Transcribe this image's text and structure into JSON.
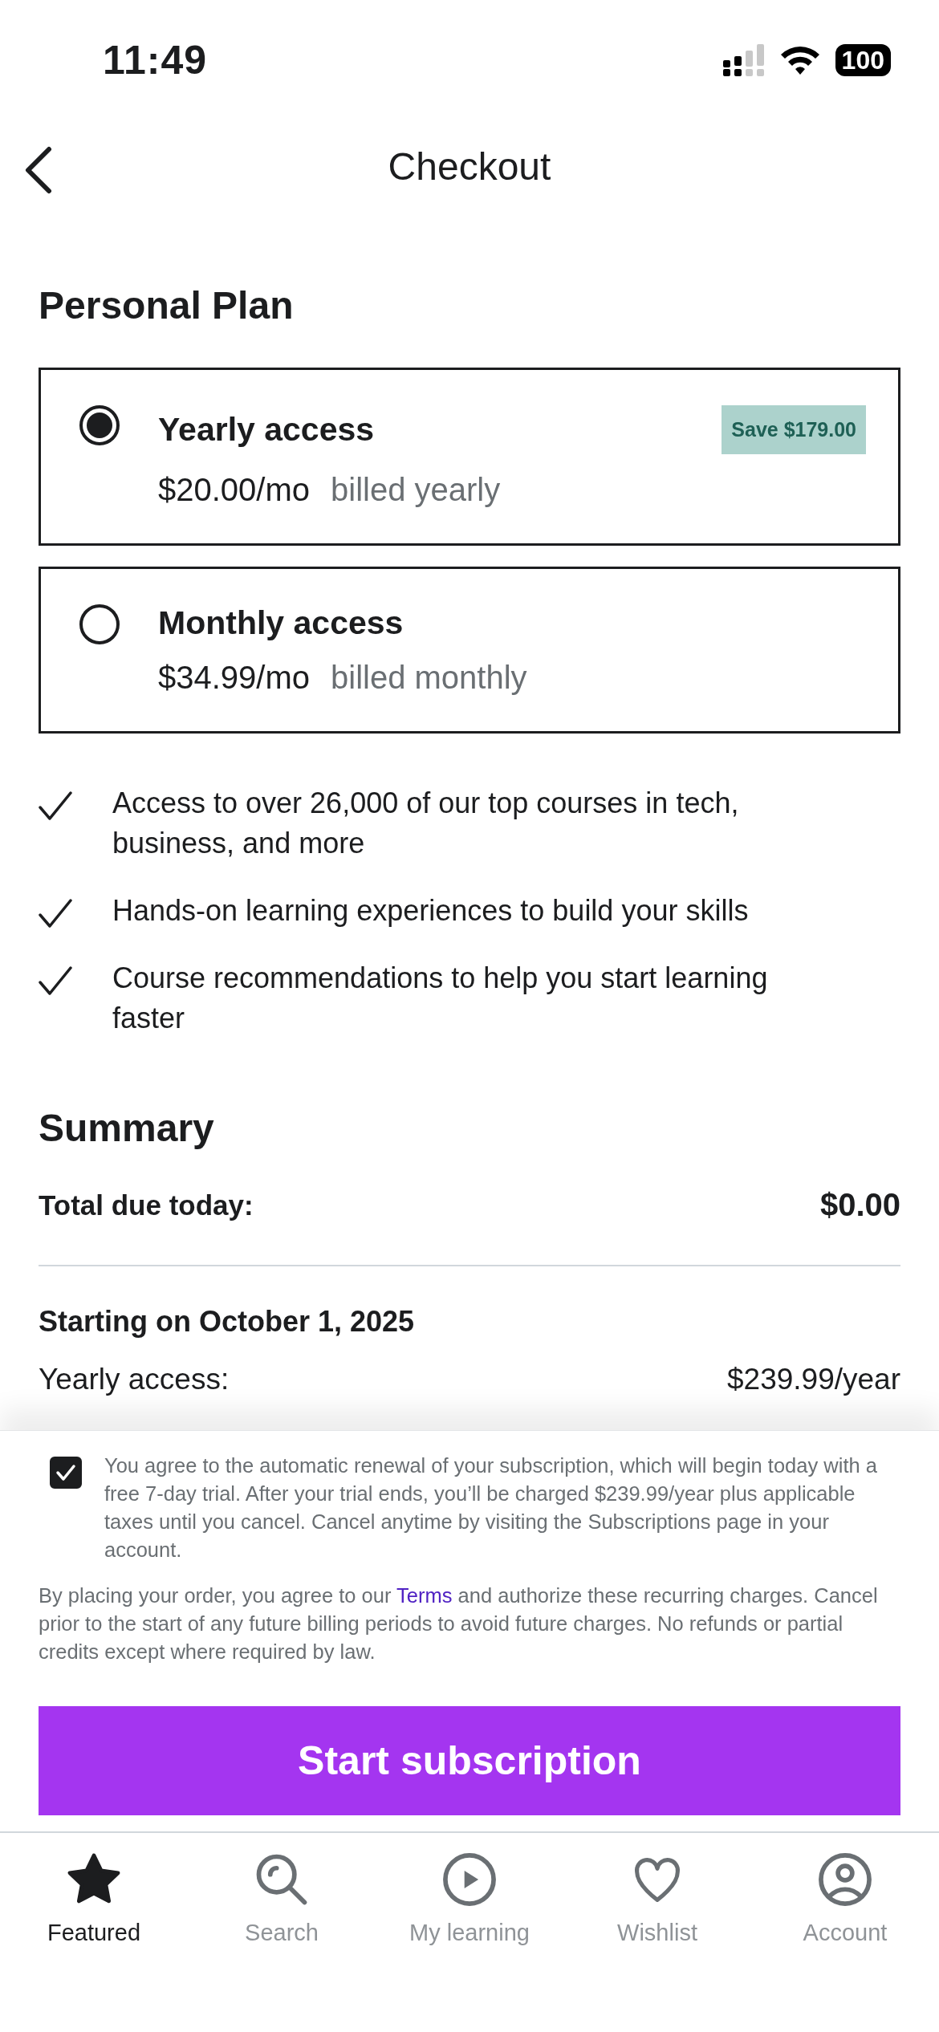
{
  "status_bar": {
    "time": "11:49",
    "battery": "100"
  },
  "header": {
    "title": "Checkout"
  },
  "plan_heading": "Personal Plan",
  "plans": [
    {
      "title": "Yearly access",
      "price": "$20.00/mo",
      "billing": "billed yearly",
      "badge": "Save $179.00",
      "selected": true
    },
    {
      "title": "Monthly access",
      "price": "$34.99/mo",
      "billing": "billed monthly",
      "selected": false
    }
  ],
  "features": [
    "Access to over 26,000 of our top courses in tech, business, and more",
    "Hands-on learning experiences to build your skills",
    "Course recommendations to help you start learning faster"
  ],
  "summary": {
    "heading": "Summary",
    "total_label": "Total due today:",
    "total_value": "$0.00",
    "start_heading": "Starting on October 1, 2025",
    "lines": [
      {
        "label": "Yearly access:",
        "value": "$239.99/year"
      }
    ]
  },
  "consent": {
    "checked": true,
    "text": "You agree to the automatic renewal of your subscription, which will begin today with a free 7-day trial. After your trial ends, you’ll be charged $239.99/year plus applicable taxes until you cancel. Cancel anytime by visiting the Subscriptions page in your account."
  },
  "legal": {
    "before": "By placing your order, you agree to our",
    "link": "Terms",
    "after": "and authorize these recurring charges. Cancel prior to the start of any future billing periods to avoid future charges. No refunds or partial credits except where required by law."
  },
  "cta": "Start subscription",
  "tabs": [
    {
      "label": "Featured",
      "kind": "star",
      "selected": true
    },
    {
      "label": "Search",
      "kind": "search",
      "selected": false
    },
    {
      "label": "My learning",
      "kind": "play",
      "selected": false
    },
    {
      "label": "Wishlist",
      "kind": "heart",
      "selected": false
    },
    {
      "label": "Account",
      "kind": "account",
      "selected": false
    }
  ]
}
